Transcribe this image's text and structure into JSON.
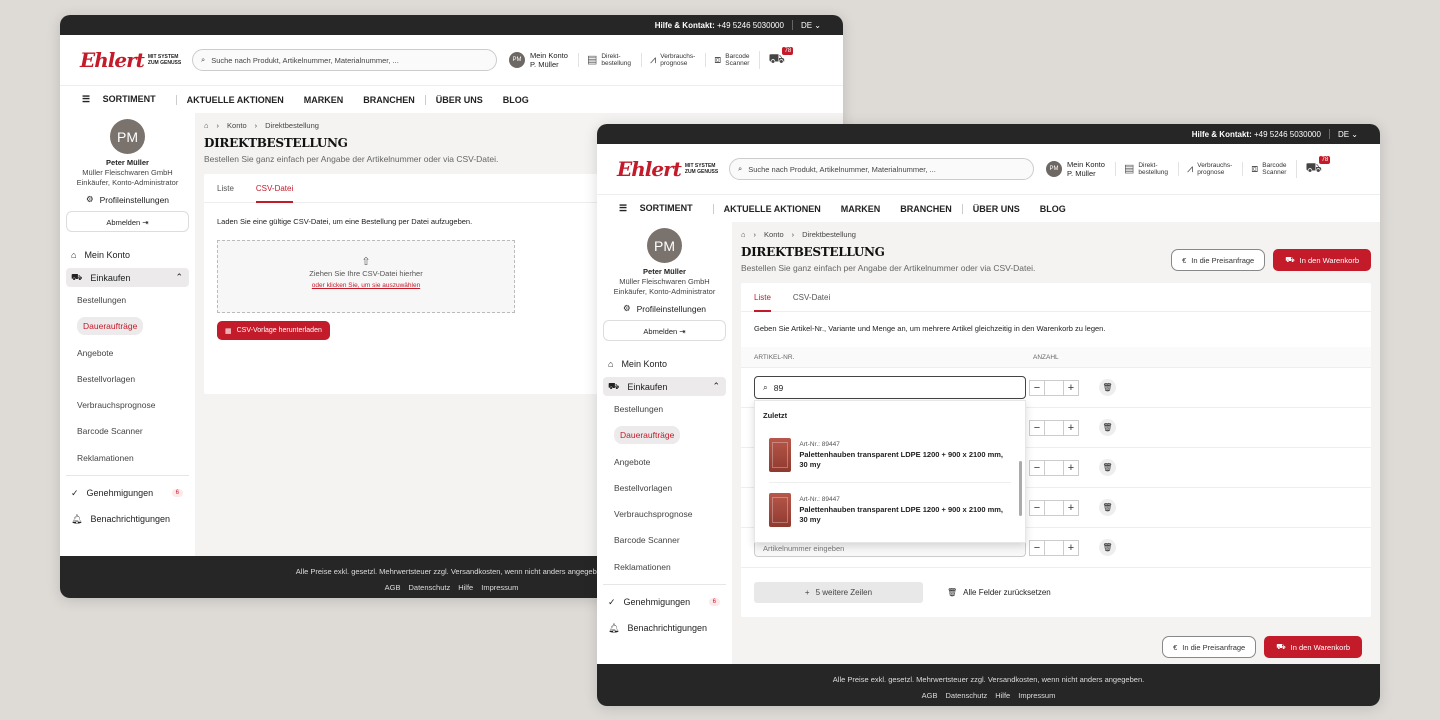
{
  "topbar": {
    "help": "Hilfe & Kontakt:",
    "phone": "+49 5246 5030000",
    "lang": "DE"
  },
  "logo": {
    "word": "Ehlert",
    "tag1": "MIT SYSTEM",
    "tag2": "ZUM GENUSS"
  },
  "search": {
    "placeholder": "Suche nach Produkt, Artikelnummer, Materialnummer, ..."
  },
  "account": {
    "initials": "PM",
    "label": "Mein Konto",
    "name": "P. Müller"
  },
  "header_items": [
    {
      "l1": "Direkt-",
      "l2": "bestellung"
    },
    {
      "l1": "Verbrauchs-",
      "l2": "prognose"
    },
    {
      "l1": "Barcode",
      "l2": "Scanner"
    }
  ],
  "cart_count": "78",
  "nav": {
    "sortiment": "SORTIMENT",
    "aktionen": "AKTUELLE AKTIONEN",
    "marken": "MARKEN",
    "branchen": "BRANCHEN",
    "ueber": "ÜBER UNS",
    "blog": "BLOG"
  },
  "profile": {
    "initials": "PM",
    "name": "Peter Müller",
    "company": "Müller Fleischwaren GmbH",
    "role": "Einkäufer, Konto-Administrator",
    "settings": "Profileinstellungen",
    "logout": "Abmelden"
  },
  "menu": {
    "konto": "Mein Konto",
    "einkaufen": "Einkaufen",
    "subs": [
      "Bestellungen",
      "Daueraufträge",
      "Angebote",
      "Bestellvorlagen",
      "Verbrauchsprognose",
      "Barcode Scanner",
      "Reklamationen"
    ],
    "genehmigungen": "Genehmigungen",
    "gen_count": "6",
    "benachrichtigungen": "Benachrichtigungen"
  },
  "crumb": {
    "konto": "Konto",
    "page": "Direktbestellung"
  },
  "page": {
    "title": "DIREKTBESTELLUNG",
    "subtitle": "Bestellen Sie ganz einfach per Angabe der Artikelnummer oder via CSV-Datei."
  },
  "tabs": {
    "liste": "Liste",
    "csv": "CSV-Datei"
  },
  "csv": {
    "desc": "Laden Sie eine gültige CSV-Datei, um eine Bestellung per Datei aufzugeben.",
    "drop": "Ziehen Sie Ihre CSV-Datei hierher",
    "link": "oder klicken Sie, um sie auszuwählen",
    "btn": "CSV-Vorlage herunterladen"
  },
  "liste": {
    "desc": "Geben Sie Artikel-Nr., Variante und Menge an, um mehrere Artikel gleichzeitig in den Warenkorb zu legen.",
    "col_art": "ARTIKEL-NR.",
    "col_anz": "ANZAHL",
    "query": "89",
    "zuletzt": "Zuletzt",
    "ghost": "Artikelnummer eingeben",
    "more": "5 weitere Zeilen",
    "reset": "Alle Felder zurücksetzen"
  },
  "products": [
    {
      "art": "Art-Nr.: 89447",
      "name": "Palettenhauben transparent LDPE 1200 + 900 x 2100 mm, 30 my"
    },
    {
      "art": "Art-Nr.: 89447",
      "name": "Palettenhauben transparent LDPE 1200 + 900 x 2100 mm, 30 my"
    }
  ],
  "buttons": {
    "preis": "In die Preisanfrage",
    "cart": "In den Warenkorb"
  },
  "footer": {
    "note": "Alle Preise exkl. gesetzl. Mehrwertsteuer zzgl. Versandkosten, wenn nicht anders angegeben.",
    "agb": "AGB",
    "ds": "Datenschutz",
    "hilfe": "Hilfe",
    "imp": "Impressum"
  },
  "colors": {
    "brand": "#c31b2a",
    "dark": "#262626"
  }
}
